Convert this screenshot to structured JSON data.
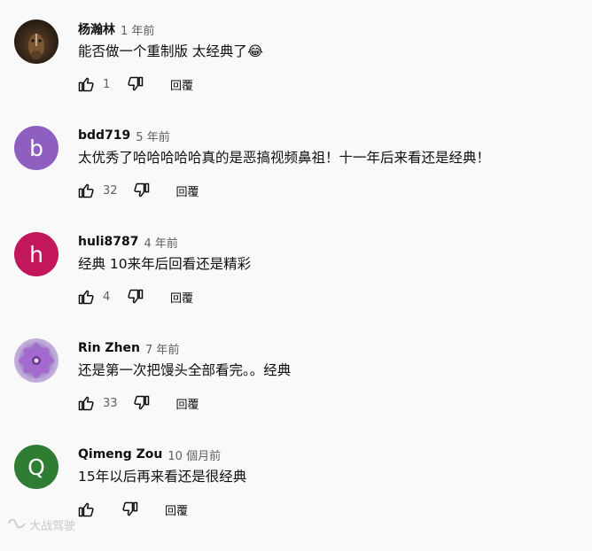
{
  "comments": [
    {
      "avatar": {
        "type": "image",
        "style": "horse"
      },
      "author": "杨瀚林",
      "time": "1 年前",
      "text": "能否做一个重制版 太经典了😂",
      "likes": "1",
      "reply_label": "回覆"
    },
    {
      "avatar": {
        "type": "letter",
        "letter": "b",
        "color": "#8e5fc1"
      },
      "author": "bdd719",
      "time": "5 年前",
      "text": "太优秀了哈哈哈哈哈真的是恶搞视频鼻祖！十一年后来看还是经典！",
      "likes": "32",
      "reply_label": "回覆"
    },
    {
      "avatar": {
        "type": "letter",
        "letter": "h",
        "color": "#c2185b"
      },
      "author": "huli8787",
      "time": "4 年前",
      "text": "经典 10来年后回看还是精彩",
      "likes": "4",
      "reply_label": "回覆"
    },
    {
      "avatar": {
        "type": "image",
        "style": "flower"
      },
      "author": "Rin Zhen",
      "time": "7 年前",
      "text": "还是第一次把馒头全部看完。。经典",
      "likes": "33",
      "reply_label": "回覆"
    },
    {
      "avatar": {
        "type": "letter",
        "letter": "Q",
        "color": "#2e7d32"
      },
      "author": "Qimeng Zou",
      "time": "10 個月前",
      "text": "15年以后再来看还是很经典",
      "likes": "",
      "reply_label": "回覆"
    }
  ],
  "watermark": {
    "text": "大战驾驶"
  }
}
